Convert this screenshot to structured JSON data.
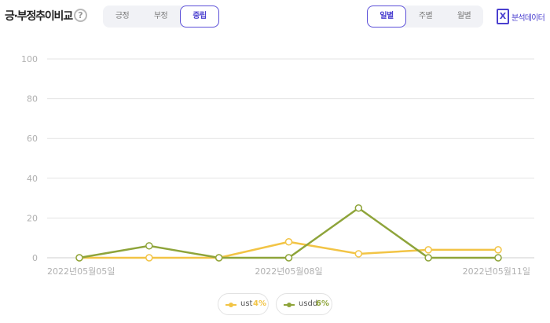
{
  "header": {
    "title": "긍·부정추이비교",
    "help_icon": "?",
    "sentiment_tabs": [
      {
        "label": "긍정",
        "active": false
      },
      {
        "label": "부정",
        "active": false
      },
      {
        "label": "중립",
        "active": true
      }
    ],
    "period_tabs": [
      {
        "label": "일별",
        "active": true
      },
      {
        "label": "주별",
        "active": false
      },
      {
        "label": "월별",
        "active": false
      }
    ],
    "excel_icon": "X",
    "excel_label": "분석데이터"
  },
  "colors": {
    "accent": "#4a3fcf",
    "series_ust": "#f2c445",
    "series_usdd": "#8ea43a",
    "grid": "#e3e3e3",
    "tick": "#b0b0b0"
  },
  "legend": [
    {
      "name": "ust",
      "pct": "4%"
    },
    {
      "name": "usdd",
      "pct": "6%"
    }
  ],
  "chart_data": {
    "type": "line",
    "x": [
      "2022-05-05",
      "2022-05-06",
      "2022-05-07",
      "2022-05-08",
      "2022-05-09",
      "2022-05-10",
      "2022-05-11"
    ],
    "x_tick_labels": [
      "2022년05월05일",
      "2022년05월08일",
      "2022년05월11일"
    ],
    "x_tick_index": [
      0,
      3,
      6
    ],
    "y_ticks": [
      "0",
      "20",
      "40",
      "60",
      "80",
      "100"
    ],
    "ylim": [
      0,
      100
    ],
    "grid": true,
    "series": [
      {
        "name": "ust",
        "color": "#f2c445",
        "values": [
          0,
          0,
          0,
          8,
          2,
          4,
          4
        ]
      },
      {
        "name": "usdd",
        "color": "#8ea43a",
        "values": [
          0,
          6,
          0,
          0,
          25,
          0,
          0
        ]
      }
    ],
    "legend_position": "bottom"
  }
}
